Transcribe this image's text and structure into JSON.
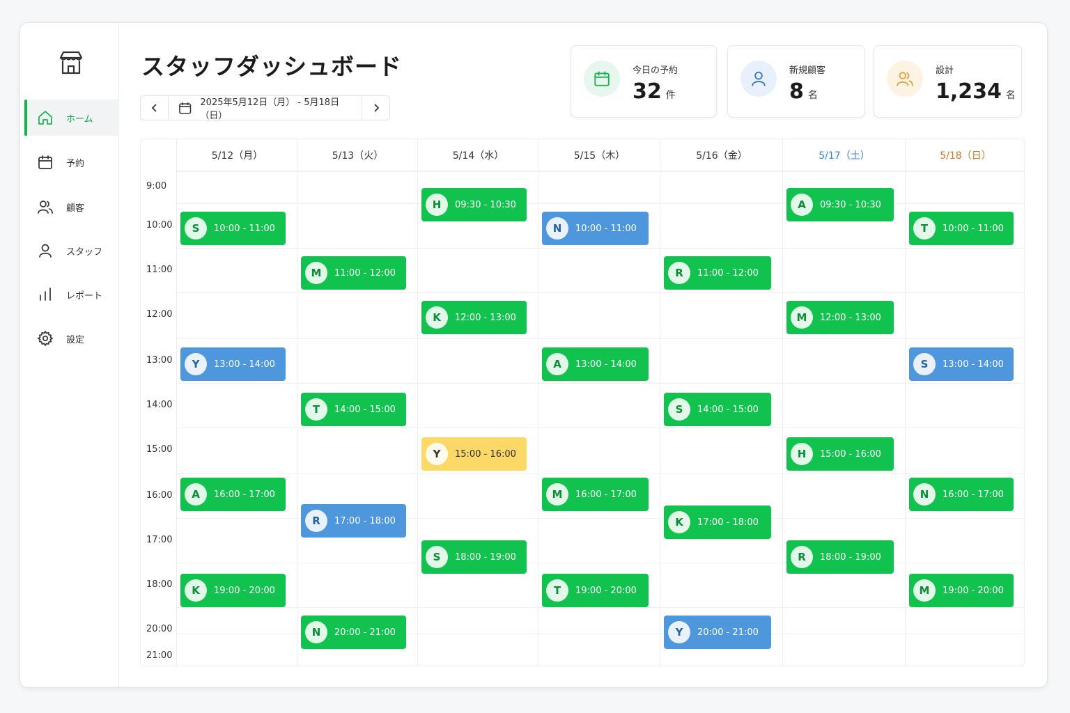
{
  "title": "スタッフダッシュボード",
  "nav": [
    {
      "label": "ホーム",
      "icon": "home-icon",
      "active": true
    },
    {
      "label": "予約",
      "icon": "calendar-icon",
      "active": false
    },
    {
      "label": "顧客",
      "icon": "users-icon",
      "active": false
    },
    {
      "label": "スタッフ",
      "icon": "user-icon",
      "active": false
    },
    {
      "label": "レポート",
      "icon": "bar-chart-icon",
      "active": false
    },
    {
      "label": "設定",
      "icon": "gear-icon",
      "active": false
    }
  ],
  "date_range": "2025年5月12日（月） - 5月18日（日）",
  "stats": [
    {
      "label": "今日の予約",
      "value": "32",
      "unit": "件",
      "icon": "calendar-icon",
      "color": "#13b54d",
      "bg": "#e8f7ee"
    },
    {
      "label": "新規顧客",
      "value": "8",
      "unit": "名",
      "icon": "user-icon",
      "color": "#3b78c4",
      "bg": "#e8f1fb"
    },
    {
      "label": "設計",
      "value": "1,234",
      "unit": "名",
      "icon": "users-icon",
      "color": "#e0a23a",
      "bg": "#fdf3e3"
    }
  ],
  "days": [
    {
      "label": "5/12（月）",
      "color": "#333333"
    },
    {
      "label": "5/13（火）",
      "color": "#333333"
    },
    {
      "label": "5/14（水）",
      "color": "#333333"
    },
    {
      "label": "5/15（木）",
      "color": "#333333"
    },
    {
      "label": "5/16（金）",
      "color": "#333333"
    },
    {
      "label": "5/17（土）",
      "color": "#3b82d6"
    },
    {
      "label": "5/18（日）",
      "color": "#c77a2a"
    }
  ],
  "hours": [
    "9:00",
    "10:00",
    "11:00",
    "12:00",
    "13:00",
    "14:00",
    "15:00",
    "16:00",
    "17:00",
    "18:00",
    "20:00",
    "21:00"
  ],
  "appointments": [
    {
      "day": 0,
      "initial": "S",
      "time": "10:00 - 11:00",
      "color": "green"
    },
    {
      "day": 0,
      "initial": "Y",
      "time": "13:00 - 14:00",
      "color": "blue"
    },
    {
      "day": 0,
      "initial": "A",
      "time": "16:00 - 17:00",
      "color": "green"
    },
    {
      "day": 0,
      "initial": "K",
      "time": "19:00 - 20:00",
      "color": "green"
    },
    {
      "day": 1,
      "initial": "M",
      "time": "11:00 - 12:00",
      "color": "green"
    },
    {
      "day": 1,
      "initial": "T",
      "time": "14:00 - 15:00",
      "color": "green"
    },
    {
      "day": 1,
      "initial": "R",
      "time": "17:00 - 18:00",
      "color": "blue"
    },
    {
      "day": 1,
      "initial": "N",
      "time": "20:00 - 21:00",
      "color": "green"
    },
    {
      "day": 2,
      "initial": "H",
      "time": "09:30 - 10:30",
      "color": "green"
    },
    {
      "day": 2,
      "initial": "K",
      "time": "12:00 - 13:00",
      "color": "green"
    },
    {
      "day": 2,
      "initial": "Y",
      "time": "15:00 - 16:00",
      "color": "yellow"
    },
    {
      "day": 2,
      "initial": "S",
      "time": "18:00 - 19:00",
      "color": "green"
    },
    {
      "day": 3,
      "initial": "N",
      "time": "10:00 - 11:00",
      "color": "blue"
    },
    {
      "day": 3,
      "initial": "A",
      "time": "13:00 - 14:00",
      "color": "green"
    },
    {
      "day": 3,
      "initial": "M",
      "time": "16:00 - 17:00",
      "color": "green"
    },
    {
      "day": 3,
      "initial": "T",
      "time": "19:00 - 20:00",
      "color": "green"
    },
    {
      "day": 4,
      "initial": "R",
      "time": "11:00 - 12:00",
      "color": "green"
    },
    {
      "day": 4,
      "initial": "S",
      "time": "14:00 - 15:00",
      "color": "green"
    },
    {
      "day": 4,
      "initial": "K",
      "time": "17:00 - 18:00",
      "color": "green"
    },
    {
      "day": 4,
      "initial": "Y",
      "time": "20:00 - 21:00",
      "color": "blue"
    },
    {
      "day": 5,
      "initial": "A",
      "time": "09:30 - 10:30",
      "color": "green"
    },
    {
      "day": 5,
      "initial": "M",
      "time": "12:00 - 13:00",
      "color": "green"
    },
    {
      "day": 5,
      "initial": "H",
      "time": "15:00 - 16:00",
      "color": "green"
    },
    {
      "day": 5,
      "initial": "R",
      "time": "18:00 - 19:00",
      "color": "green"
    },
    {
      "day": 6,
      "initial": "T",
      "time": "10:00 - 11:00",
      "color": "green"
    },
    {
      "day": 6,
      "initial": "S",
      "time": "13:00 - 14:00",
      "color": "blue"
    },
    {
      "day": 6,
      "initial": "N",
      "time": "16:00 - 17:00",
      "color": "green"
    },
    {
      "day": 6,
      "initial": "M",
      "time": "19:00 - 20:00",
      "color": "green"
    }
  ]
}
